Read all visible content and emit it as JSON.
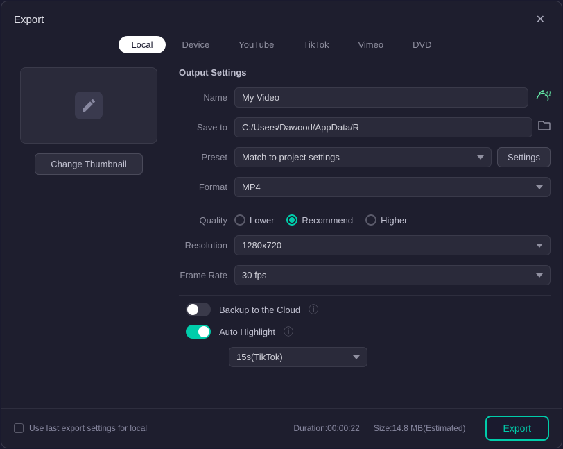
{
  "dialog": {
    "title": "Export",
    "close_label": "✕"
  },
  "tabs": [
    {
      "id": "local",
      "label": "Local",
      "active": true
    },
    {
      "id": "device",
      "label": "Device",
      "active": false
    },
    {
      "id": "youtube",
      "label": "YouTube",
      "active": false
    },
    {
      "id": "tiktok",
      "label": "TikTok",
      "active": false
    },
    {
      "id": "vimeo",
      "label": "Vimeo",
      "active": false
    },
    {
      "id": "dvd",
      "label": "DVD",
      "active": false
    }
  ],
  "thumbnail": {
    "change_label": "Change Thumbnail"
  },
  "output": {
    "section_title": "Output Settings",
    "name_label": "Name",
    "name_value": "My Video",
    "save_to_label": "Save to",
    "save_to_value": "C:/Users/Dawood/AppData/R",
    "preset_label": "Preset",
    "preset_value": "Match to project settings",
    "settings_label": "Settings",
    "format_label": "Format",
    "format_value": "MP4",
    "quality_label": "Quality",
    "quality_options": [
      {
        "id": "lower",
        "label": "Lower",
        "checked": false
      },
      {
        "id": "recommend",
        "label": "Recommend",
        "checked": true
      },
      {
        "id": "higher",
        "label": "Higher",
        "checked": false
      }
    ],
    "resolution_label": "Resolution",
    "resolution_value": "1280x720",
    "framerate_label": "Frame Rate",
    "framerate_value": "30 fps",
    "backup_label": "Backup to the Cloud",
    "backup_on": false,
    "autohighlight_label": "Auto Highlight",
    "autohighlight_on": true,
    "tiktok_value": "15s(TikTok)"
  },
  "footer": {
    "checkbox_label": "Use last export settings for local",
    "duration_label": "Duration:00:00:22",
    "size_label": "Size:14.8 MB(Estimated)",
    "export_label": "Export"
  },
  "icons": {
    "edit": "✏",
    "folder": "📁",
    "help": "?"
  }
}
